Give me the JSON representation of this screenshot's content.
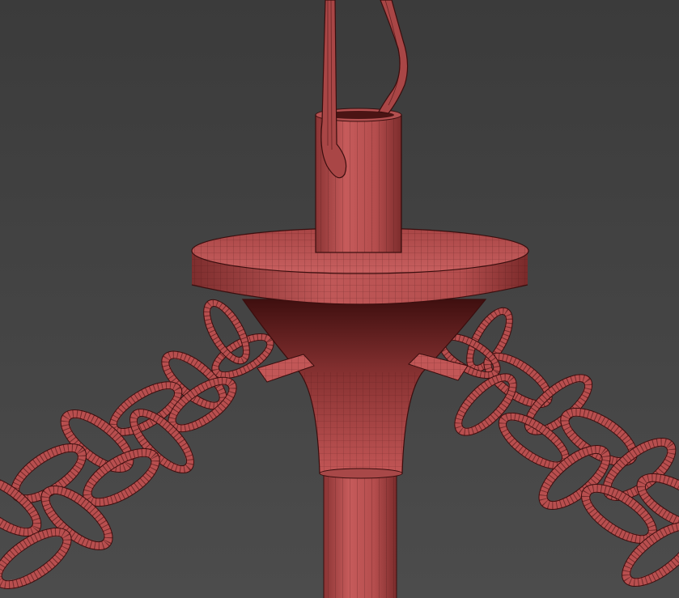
{
  "viewport": {
    "background_top": "#3b3b3b",
    "background_bottom": "#4c4c4c",
    "model_color": "#b84f4f",
    "model_shadow": "#6e2424",
    "wire_color": "#3a0e0e"
  }
}
